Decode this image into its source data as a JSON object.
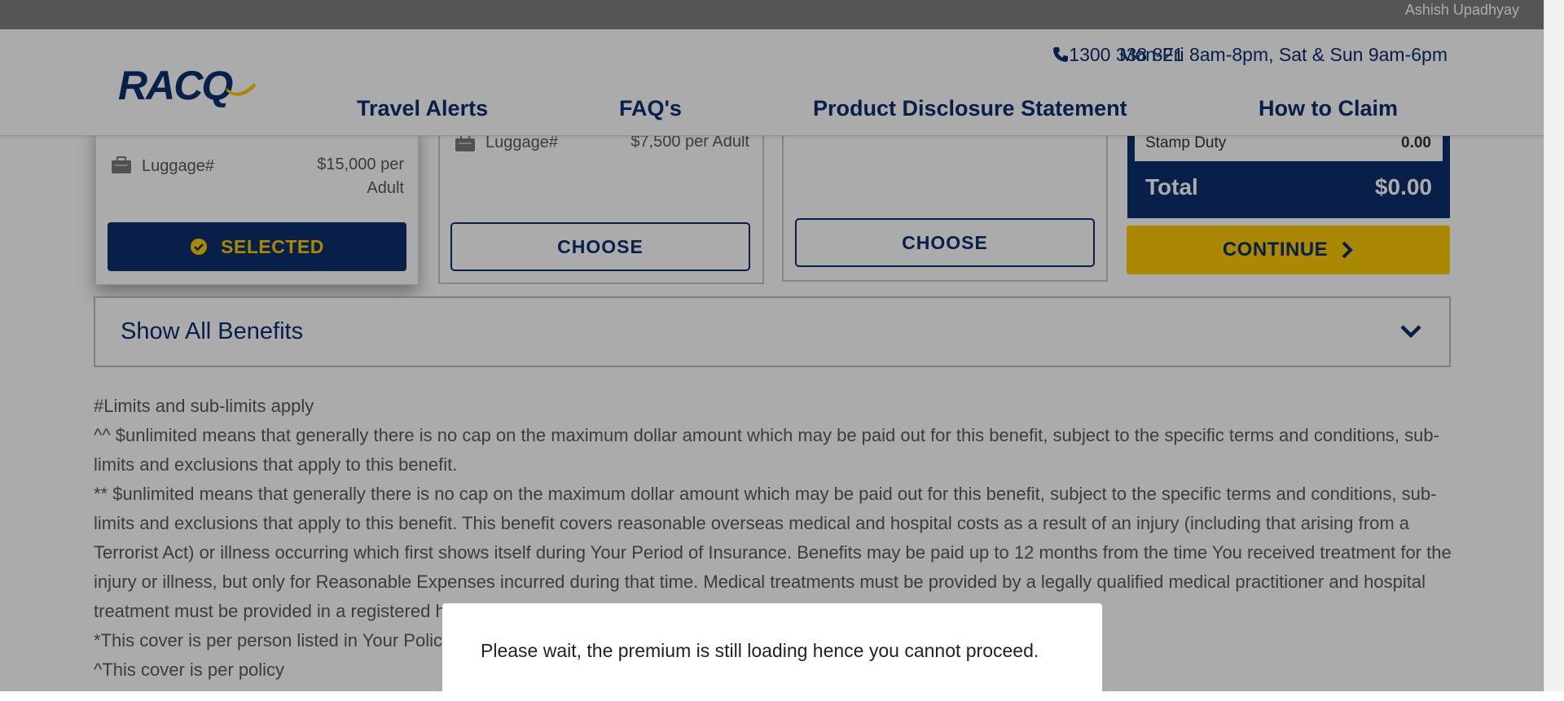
{
  "topbar": {
    "username": "Ashish Upadhyay"
  },
  "header": {
    "logo": "RACQ",
    "phone": "1300 338 821",
    "hours": "Mon-Fri 8am-8pm, Sat & Sun 9am-6pm",
    "nav": [
      "Travel Alerts",
      "FAQ's",
      "Product Disclosure Statement",
      "How to Claim"
    ]
  },
  "plans": [
    {
      "benefit_label": "Luggage#",
      "benefit_value_line1": "$15,000 per",
      "benefit_value_line2": "Adult",
      "button_label": "SELECTED"
    },
    {
      "benefit_label": "Luggage#",
      "benefit_value": "$7,500 per Adult",
      "button_label": "CHOOSE"
    },
    {
      "button_label": "CHOOSE"
    }
  ],
  "summary": {
    "stamp_duty_label": "Stamp Duty",
    "stamp_duty_value": "0.00",
    "total_label": "Total",
    "total_value": "$0.00",
    "continue_label": "CONTINUE"
  },
  "benefits_toggle": {
    "label": "Show All Benefits"
  },
  "disclaimer": [
    "#Limits and sub-limits apply",
    "^^ $unlimited means that generally there is no cap on the maximum dollar amount which may be paid out for this benefit, subject to the specific terms and conditions, sub-limits and exclusions that apply to this benefit.",
    "** $unlimited means that generally there is no cap on the maximum dollar amount which may be paid out for this benefit, subject to the specific terms and conditions, sub-limits and exclusions that apply to this benefit. This benefit covers reasonable overseas medical and hospital costs as a result of an injury (including that arising from a Terrorist Act) or illness occurring which first shows itself during Your Period of Insurance. Benefits may be paid up to 12 months from the time You received treatment for the injury or illness, but only for Reasonable Expenses incurred during that time. Medical treatments must be provided by a legally qualified medical practitioner and hospital treatment must be provided in a registered hospital.",
    "*This cover is per person listed in Your Policy.",
    "^This cover is per policy"
  ],
  "modal": {
    "message": "Please wait, the premium is still loading hence you cannot proceed."
  },
  "colors": {
    "brand_navy": "#0b2f6e",
    "brand_yellow": "#ffcb05"
  },
  "icons": [
    "phone-icon",
    "luggage-icon",
    "check-circle-icon",
    "chevron-right-icon",
    "chevron-down-icon"
  ]
}
